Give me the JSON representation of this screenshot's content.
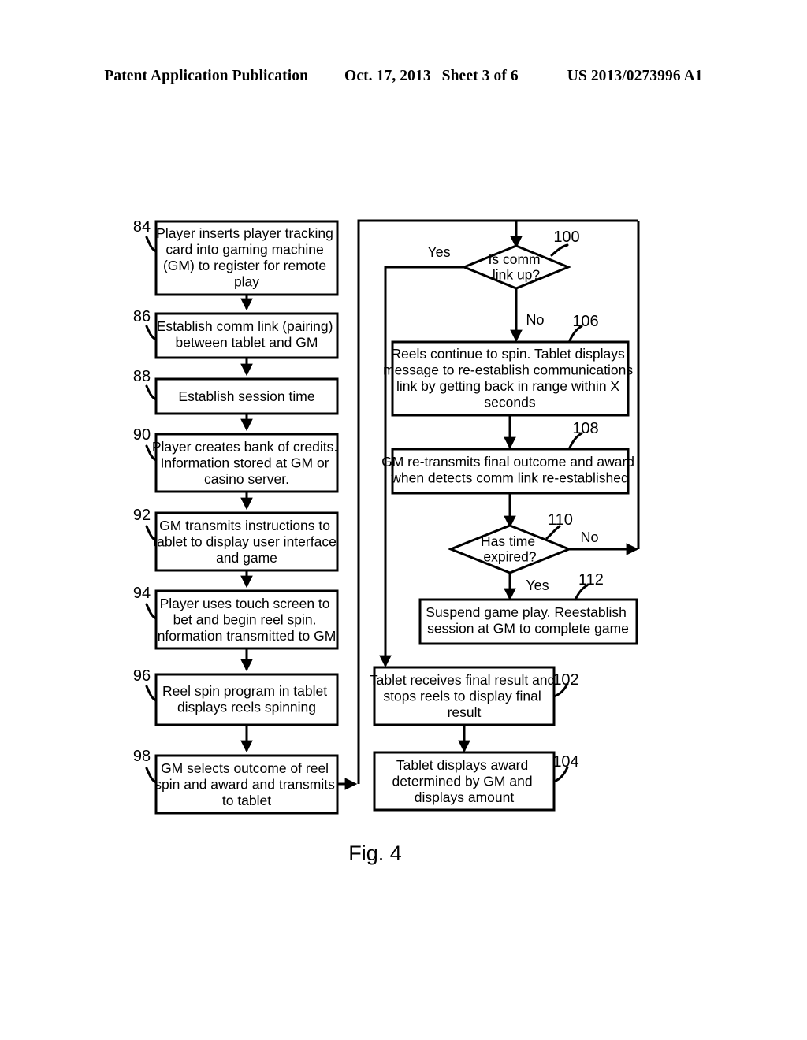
{
  "header": {
    "publication": "Patent Application Publication",
    "date": "Oct. 17, 2013",
    "sheet": "Sheet 3 of 6",
    "patent_number": "US 2013/0273996 A1"
  },
  "figure": {
    "caption": "Fig. 4",
    "colors": {
      "stroke": "#000000",
      "fill": "#ffffff"
    }
  },
  "flowchart": {
    "left_column": [
      {
        "ref": "84",
        "lines": [
          "Player inserts player tracking",
          "card into gaming machine",
          "(GM) to register for remote",
          "play"
        ]
      },
      {
        "ref": "86",
        "lines": [
          "Establish comm link (pairing)",
          "between tablet and GM"
        ]
      },
      {
        "ref": "88",
        "lines": [
          "Establish session time"
        ]
      },
      {
        "ref": "90",
        "lines": [
          "Player creates bank of credits.",
          "Information stored at GM or",
          "casino server."
        ]
      },
      {
        "ref": "92",
        "lines": [
          "GM transmits instructions to",
          "tablet to display user interface",
          "and game"
        ]
      },
      {
        "ref": "94",
        "lines": [
          "Player uses touch screen to",
          "bet and begin reel spin.",
          "Information transmitted to GM."
        ]
      },
      {
        "ref": "96",
        "lines": [
          "Reel spin program in tablet",
          "displays reels spinning"
        ]
      },
      {
        "ref": "98",
        "lines": [
          "GM selects outcome of reel",
          "spin and award and transmits",
          "to tablet"
        ]
      }
    ],
    "right_column": [
      {
        "ref": "100",
        "shape": "decision",
        "lines": [
          "Is comm",
          "link up?"
        ]
      },
      {
        "ref": "106",
        "shape": "process",
        "lines": [
          "Reels continue to spin.  Tablet displays",
          "message to re-establish communications",
          "link by getting back in range within X",
          "seconds"
        ]
      },
      {
        "ref": "108",
        "shape": "process",
        "lines": [
          "GM re-transmits final outcome and award",
          "when detects comm link re-established"
        ]
      },
      {
        "ref": "110",
        "shape": "decision",
        "lines": [
          "Has time",
          "expired?"
        ]
      },
      {
        "ref": "112",
        "shape": "process",
        "lines": [
          "Suspend game play.  Reestablish",
          "session at GM to complete game"
        ]
      },
      {
        "ref": "102",
        "shape": "process",
        "lines": [
          "Tablet receives final result and",
          "stops reels to display final",
          "result"
        ]
      },
      {
        "ref": "104",
        "shape": "process",
        "lines": [
          "Tablet displays award",
          "determined by GM and",
          "displays amount"
        ]
      }
    ],
    "branch_labels": {
      "comm_yes": "Yes",
      "comm_no": "No",
      "time_no": "No",
      "time_yes": "Yes"
    }
  }
}
